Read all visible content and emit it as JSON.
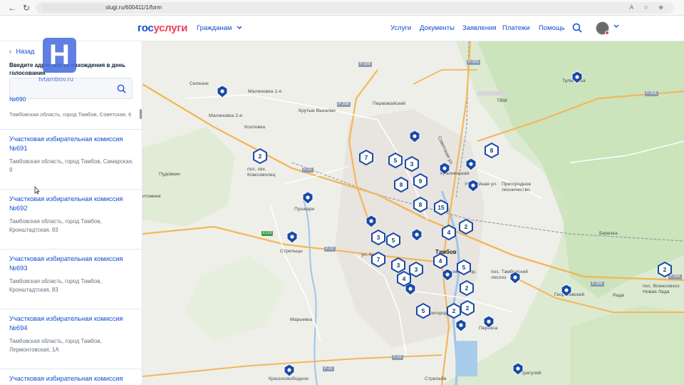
{
  "browser": {
    "address_url": "slugi.ru/600411/1/form",
    "right_icons": "A  ☆  ⊕"
  },
  "header": {
    "logo_part1": "гос",
    "logo_part2": "услуги",
    "citizens_menu": "Гражданам",
    "nav": [
      "Услуги",
      "Документы",
      "Заявления",
      "Платежи",
      "Помощь"
    ]
  },
  "sidebar": {
    "back_label": "Назад",
    "hint": "Введите адрес места нахождения в день голосования",
    "partial_title": "№690",
    "partial_address": "Тамбовская область, город Тамбов, Советская, 6",
    "items": [
      {
        "title": "Участковая избирательная комиссия №691",
        "address": "Тамбовская область, город Тамбов, Самарская, 9"
      },
      {
        "title": "Участковая избирательная комиссия №692",
        "address": "Тамбовская область, город Тамбов, Кронштадтская, 83"
      },
      {
        "title": "Участковая избирательная комиссия №693",
        "address": "Тамбовская область, город Тамбов, Кронштадтская, 83"
      },
      {
        "title": "Участковая избирательная комиссия №694",
        "address": "Тамбовская область, город Тамбов, Лермонтовская, 1А"
      },
      {
        "title": "Участковая избирательная комиссия",
        "address": ""
      }
    ]
  },
  "watermark": {
    "letter": "Н",
    "site": "tvtambov.ru"
  },
  "map": {
    "labels": {
      "selezni": "Селезни",
      "malinovka1": "Малиновка 1-я",
      "malinovka2": "Малиновка 2-я",
      "krutye": "Крутые Выселки",
      "pervomaisky": "Первомайский",
      "kozlovka": "Козловка",
      "komsomolets": "пос. свх. Комсомолец",
      "pudovkin": "Пудовкин",
      "pitomnik": "итомник",
      "pushkari": "Пушкари",
      "streltsy": "Стрельцы",
      "tambov": "Тамбов",
      "maryevka": "Марьевка",
      "krasnosvobodnoe": "Красносвободное",
      "strelbishe": "Стрельби",
      "tuleyovka": "Тулиновка",
      "tvb": "TBW",
      "prigorodnoe": "Пригородное лесничество",
      "berezka": "Березка",
      "tambovskiy": "пос. Тамбовский лесхоз",
      "voenovkhoz": "пос. Военсовхоз Новая Лада",
      "georgievskiy": "Георгиевский",
      "rada": "Рада",
      "pereksa": "Перекса",
      "trigulyai": "Тригуляй",
      "priigorodny": "Пригородный",
      "uroshaynaya": "Урожайная ул.",
      "sovetskaya": "Советская ул.",
      "leninsky": "Ленинский пр.",
      "kirova": "ул. Киро",
      "krasnenkaya": "Красненькая"
    },
    "roads": {
      "r208": "Р-208",
      "r208b": "Р-208",
      "r22": "Р-22",
      "e119": "Е119",
      "r22b": "Р-22",
      "r193": "Р-193",
      "r208c": "Р-208",
      "r206": "Р-206",
      "r206b": "Р-206",
      "r22c": "Р-22",
      "r22d": "Р-22"
    },
    "clusters": [
      "2",
      "7",
      "5",
      "3",
      "8",
      "9",
      "8",
      "8",
      "15",
      "4",
      "2",
      "3",
      "5",
      "7",
      "3",
      "3",
      "4",
      "4",
      "5",
      "2",
      "5",
      "2",
      "2",
      "2"
    ]
  },
  "colors": {
    "brand_blue": "#0d4cd3",
    "brand_red": "#ee3f58",
    "marker": "#1a4aa8"
  }
}
